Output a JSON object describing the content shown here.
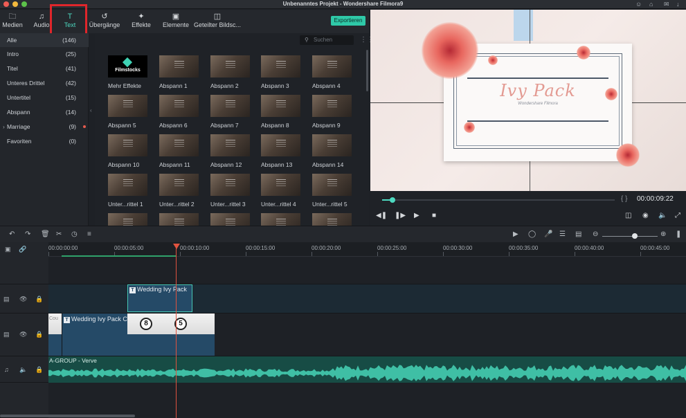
{
  "window": {
    "title": "Unbenanntes Projekt - Wondershare Filmora9"
  },
  "toolbar": {
    "tabs": [
      {
        "label": "Medien",
        "icon": "folder-icon"
      },
      {
        "label": "Audio",
        "icon": "music-note-icon"
      },
      {
        "label": "Text",
        "icon": "text-icon",
        "active": true
      },
      {
        "label": "Übergänge",
        "icon": "transition-icon"
      },
      {
        "label": "Effekte",
        "icon": "effects-icon"
      },
      {
        "label": "Elemente",
        "icon": "image-icon"
      },
      {
        "label": "Geteilter Bildsc...",
        "icon": "split-screen-icon"
      }
    ],
    "export_label": "Exportieren",
    "accent_color": "#4dd9c0"
  },
  "categories": [
    {
      "label": "Alle",
      "count": "(146)",
      "selected": true
    },
    {
      "label": "Intro",
      "count": "(25)"
    },
    {
      "label": "Titel",
      "count": "(41)"
    },
    {
      "label": "Unteres Drittel",
      "count": "(42)"
    },
    {
      "label": "Untertitel",
      "count": "(15)"
    },
    {
      "label": "Abspann",
      "count": "(14)"
    },
    {
      "label": "Marriage",
      "count": "(9)",
      "expandable": true,
      "new": true
    },
    {
      "label": "Favoriten",
      "count": "(0)"
    }
  ],
  "library": {
    "search_placeholder": "Suchen",
    "logo_text": "Filmstocks",
    "items": [
      "Mehr Effekte",
      "Abspann 1",
      "Abspann 2",
      "Abspann 3",
      "Abspann 4",
      "Abspann 5",
      "Abspann 6",
      "Abspann 7",
      "Abspann 8",
      "Abspann 9",
      "Abspann 10",
      "Abspann 11",
      "Abspann 12",
      "Abspann 13",
      "Abspann 14",
      "Unter...rittel 1",
      "Unter...rittel 2",
      "Unter...rittel 3",
      "Unter...rittel 4",
      "Unter...rittel 5"
    ]
  },
  "preview": {
    "title": "Ivy Pack",
    "subtitle": "Wondershare Filmora",
    "timecode": "00:00:09:22",
    "progress": 0.04
  },
  "timeline": {
    "ruler_labels": [
      "00:00:00:00",
      "00:00:05:00",
      "00:00:10:00",
      "00:00:15:00",
      "00:00:20:00",
      "00:00:25:00",
      "00:00:30:00",
      "00:00:35:00",
      "00:00:40:00",
      "00:00:45:00"
    ],
    "playhead_time": "00:00:09:22",
    "text_clip_label": "Wedding Ivy Pack",
    "video_clip_label": "Wedding Ivy Pack C",
    "video_clip_prefix": "Cou",
    "countdown_numbers": [
      "8",
      "5"
    ],
    "audio_clip_label": "A-GROUP - Verve",
    "audio_color": "#3fbfa5",
    "zoom_level": 0.55
  }
}
